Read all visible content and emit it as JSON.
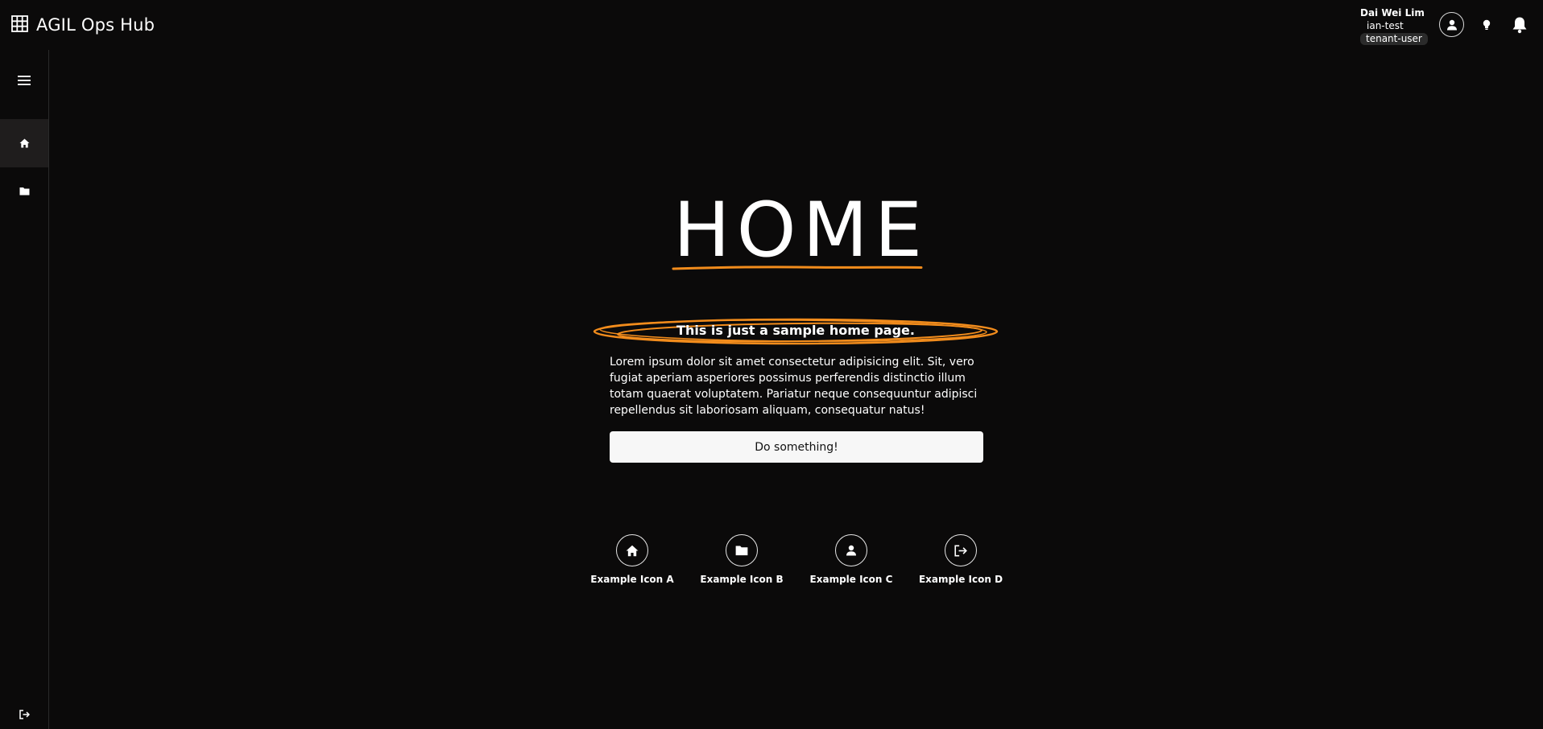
{
  "header": {
    "app_title": "AGIL Ops Hub",
    "app_icon": "grid-icon",
    "user": {
      "name": "Dai Wei Lim",
      "tenant": "ian-test",
      "role": "tenant-user"
    },
    "icons": [
      "account-icon",
      "lightbulb-icon",
      "bell-icon"
    ]
  },
  "sidebar": {
    "items": [
      {
        "name": "menu",
        "icon": "hamburger-icon"
      },
      {
        "name": "home",
        "icon": "home-icon",
        "active": true
      },
      {
        "name": "folder",
        "icon": "folder-icon"
      },
      {
        "name": "logout",
        "icon": "logout-icon"
      }
    ]
  },
  "main": {
    "title": "HOME",
    "subtitle": "This is just a sample home page.",
    "body": "Lorem ipsum dolor sit amet consectetur adipisicing elit. Sit, vero fugiat aperiam asperiores possimus perferendis distinctio illum totam quaerat voluptatem. Pariatur neque consequuntur adipisci repellendus sit laboriosam aliquam, consequatur natus!",
    "button_label": "Do something!",
    "icon_items": [
      {
        "label": "Example Icon A",
        "icon": "home-icon"
      },
      {
        "label": "Example Icon B",
        "icon": "folder-icon"
      },
      {
        "label": "Example Icon C",
        "icon": "person-icon"
      },
      {
        "label": "Example Icon D",
        "icon": "logout-icon"
      }
    ]
  },
  "colors": {
    "background": "#0b0a0a",
    "accent": "#f28c1c",
    "text": "#ffffff",
    "button_bg": "#f7f7f7"
  }
}
